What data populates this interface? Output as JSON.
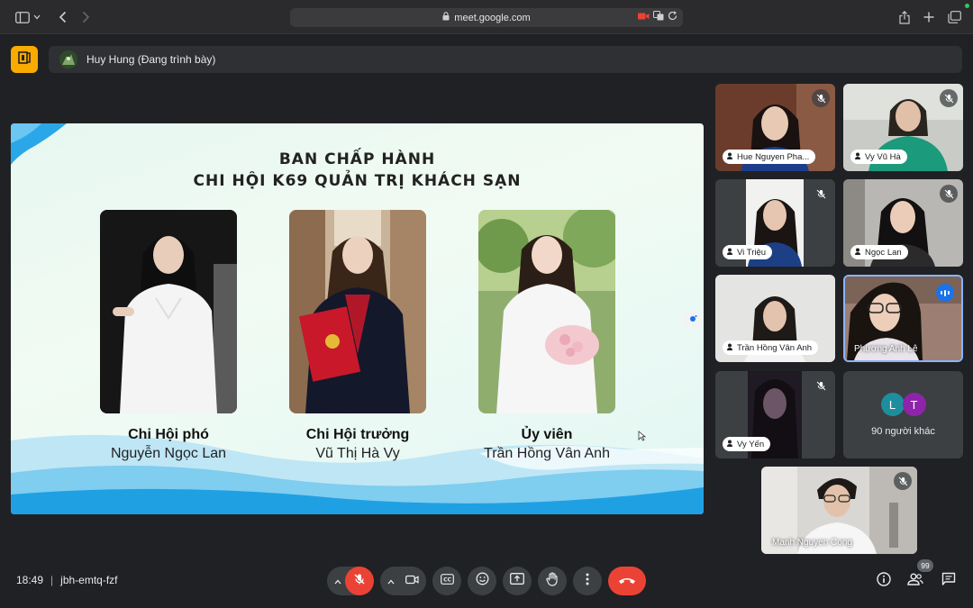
{
  "browser": {
    "url": "meet.google.com"
  },
  "presenter": {
    "label": "Huy Hung (Đang trình bày)"
  },
  "slide": {
    "title_line1": "BAN CHẤP HÀNH",
    "title_line2": "CHI HỘI K69 QUẢN TRỊ KHÁCH SẠN",
    "members": [
      {
        "role": "Chi Hội phó",
        "name": "Nguyễn Ngọc Lan"
      },
      {
        "role": "Chi Hội trưởng",
        "name": "Vũ Thị Hà Vy"
      },
      {
        "role": "Ủy viên",
        "name": "Trần Hồng Vân Anh"
      }
    ]
  },
  "participants": [
    {
      "name": "Hue Nguyen Pha..."
    },
    {
      "name": "Vy Vũ Hà"
    },
    {
      "name": "Vi Triệu"
    },
    {
      "name": "Ngọc Lan"
    },
    {
      "name": "Trần Hồng Vân Anh"
    },
    {
      "name": "Phương Anh Lê"
    },
    {
      "name": "Vy Yến"
    },
    {
      "name": "Manh Nguyen Cong"
    }
  ],
  "others": {
    "avatars": [
      "L",
      "T"
    ],
    "colors": [
      "#1e8e9e",
      "#8e24aa"
    ],
    "label": "90 người khác"
  },
  "meeting": {
    "time": "18:49",
    "code": "jbh-emtq-fzf",
    "people_count": "99"
  },
  "colors": {
    "hangup": "#ea4335",
    "speaking": "#1a73e8",
    "accent": "#f9ab00"
  }
}
